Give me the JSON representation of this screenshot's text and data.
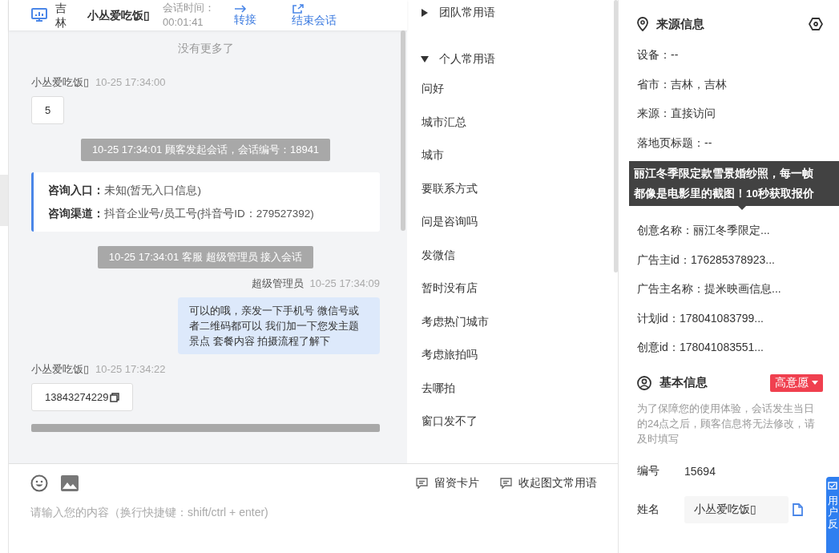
{
  "header": {
    "region": "吉林",
    "customer": "小丛爱吃饭▯",
    "duration_label": "会话时间：",
    "duration": "00:01:41",
    "actions": [
      {
        "kind": "transfer",
        "label": "转接"
      },
      {
        "kind": "end",
        "label": "结束会话"
      }
    ]
  },
  "chat": {
    "no_more": "没有更多了",
    "messages": [
      {
        "kind": "customer",
        "sender": "小丛爱吃饭▯",
        "time": "10-25 17:34:00",
        "text": "5"
      },
      {
        "kind": "system",
        "text": "10-25 17:34:01 顾客发起会话，会话编号：18941"
      },
      {
        "kind": "info",
        "lines": [
          {
            "label": "咨询入口：",
            "value": "未知(暂无入口信息)"
          },
          {
            "label": "咨询渠道：",
            "value": "抖音企业号/员工号(抖音号ID：279527392)"
          }
        ]
      },
      {
        "kind": "system",
        "text": "10-25 17:34:01 客服 超级管理员 接入会话"
      },
      {
        "kind": "agent",
        "sender": "超级管理员",
        "time": "10-25 17:34:09",
        "text": "可以的哦，亲发一下手机号 微信号或者二维码都可以 我们加一下您发主题景点 套餐内容 拍摄流程了解下"
      },
      {
        "kind": "customer",
        "sender": "小丛爱吃饭▯",
        "time": "10-25 17:34:22",
        "text": "13843274229",
        "copy": true
      },
      {
        "kind": "system_cut"
      }
    ]
  },
  "phrases": {
    "groups": [
      {
        "label": "团队常用语",
        "expanded": false
      },
      {
        "label": "个人常用语",
        "expanded": true,
        "items": [
          "问好",
          "城市汇总",
          "城市",
          "要联系方式",
          "问是咨询吗",
          "发微信",
          "暂时没有店",
          "考虑热门城市",
          "考虑旅拍吗",
          "去哪拍",
          "窗口发不了"
        ]
      }
    ]
  },
  "composer": {
    "tools": [
      {
        "label": "留资卡片"
      },
      {
        "label": "收起图文常用语"
      }
    ],
    "placeholder": "请输入您的内容（换行快捷键：shift/ctrl + enter)"
  },
  "source": {
    "title": "来源信息",
    "fields": [
      {
        "kind": "field",
        "label": "设备：",
        "value": "--"
      },
      {
        "kind": "field",
        "label": "省市：",
        "value": "吉林，吉林"
      },
      {
        "kind": "field",
        "label": "来源：",
        "value": "直接访问"
      },
      {
        "kind": "field",
        "label": "落地页标题：",
        "value": "--"
      },
      {
        "kind": "tooltip",
        "lines": [
          "丽江冬季限定款雪景婚纱照，每一帧",
          "都像是电影里的截图！10秒获取报价"
        ]
      },
      {
        "kind": "field",
        "label": "创意名称：",
        "value": "丽江冬季限定..."
      },
      {
        "kind": "field",
        "label": "广告主id：",
        "value": "176285378923..."
      },
      {
        "kind": "field",
        "label": "广告主名称：",
        "value": "提米映画信息..."
      },
      {
        "kind": "field",
        "label": "计划id：",
        "value": "178041083799..."
      },
      {
        "kind": "field",
        "label": "创意id：",
        "value": "178041083551..."
      }
    ]
  },
  "basic": {
    "title": "基本信息",
    "intent": "高意愿",
    "notice": "为了保障您的使用体验，会话发生当日的24点之后，顾客信息将无法修改，请及时填写",
    "number_label": "编号",
    "number": "15694",
    "name_label": "姓名",
    "name": "小丛爱吃饭▯"
  },
  "feedback": {
    "label": "用户反"
  }
}
